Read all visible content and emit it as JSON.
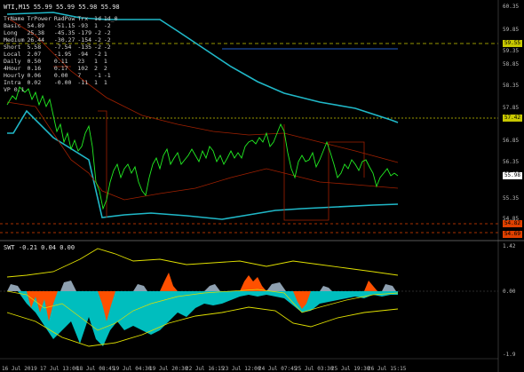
{
  "symbol_header": "WTI,M15  55.99 55.99 55.98 55.98",
  "stats_table": {
    "headers": [
      "TrName",
      "TrPower",
      "RadPow",
      "Trx",
      "1d",
      "1d_0"
    ],
    "rows": [
      [
        "Basic",
        "54.89",
        "-51.15",
        "-93",
        "1",
        "-2"
      ],
      [
        "Long",
        "25.38",
        "-45.35",
        "-179",
        "-2",
        "-2"
      ],
      [
        "Medium",
        "26.44",
        "-30.27",
        "-154",
        "-2",
        "-2"
      ],
      [
        "Short",
        "5.58",
        "-7.54",
        "-135",
        "-2",
        "-2"
      ],
      [
        "Local",
        "2.07",
        "-1.95",
        "-94",
        "-2",
        "1"
      ],
      [
        "Daily",
        "0.50",
        "0.11",
        "23",
        "1",
        "1"
      ],
      [
        "4Hour",
        "0.16",
        "0.17",
        "102",
        "2",
        "2"
      ],
      [
        "Hourly",
        "0.06",
        "0.00",
        "7",
        "-1",
        "-1"
      ],
      [
        "Intra",
        "0.02",
        "-0.00",
        "-11",
        "1",
        "1"
      ],
      [
        "VP 0.1",
        "",
        "",
        "",
        "",
        ""
      ]
    ]
  },
  "main_price_axis": [
    "60.35",
    "59.85",
    "59.35",
    "58.85",
    "58.35",
    "57.85",
    "57.35",
    "56.85",
    "56.35",
    "55.85",
    "55.35",
    "54.85"
  ],
  "highlight_labels": [
    {
      "text": "59.55",
      "bg": "#c8c800",
      "fg": "#000000"
    },
    {
      "text": "57.42",
      "bg": "#c8c800",
      "fg": "#000000"
    },
    {
      "text": "55.98",
      "bg": "#ffffff",
      "fg": "#000000"
    },
    {
      "text": "54.82",
      "bg": "#e04000",
      "fg": "#000000"
    },
    {
      "text": "54.69",
      "bg": "#e04000",
      "fg": "#000000"
    }
  ],
  "sub_header": "SWT  -0.21  0.04 0.00",
  "sub_axis": [
    "1.42",
    "0.00",
    "-1.9"
  ],
  "time_axis": [
    "16 Jul 2019",
    "17 Jul 13:00",
    "18 Jul 08:45",
    "19 Jul 04:30",
    "19 Jul 20:30",
    "22 Jul 16:15",
    "23 Jul 12:00",
    "24 Jul 07:45",
    "25 Jul 03:30",
    "25 Jul 19:30",
    "26 Jul 15:15"
  ],
  "colors": {
    "price": "#22ee22",
    "band_main": "#20b8c8",
    "band_red": "#a02000",
    "dashed": "#c8c800",
    "support": "#e04000",
    "hist_cyan": "#00c8c8",
    "hist_orange": "#ff5000",
    "hist_gray": "#8ea0b0",
    "envelope": "#e0e000"
  }
}
